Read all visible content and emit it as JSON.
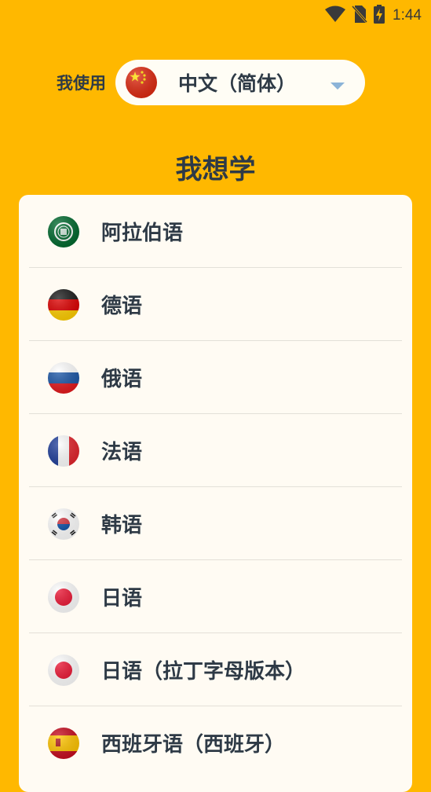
{
  "status_bar": {
    "time": "1:44",
    "icons": [
      "wifi-icon",
      "no-sim-icon",
      "battery-charging-icon"
    ]
  },
  "native_language": {
    "label": "我使用",
    "selected": "中文（简体）",
    "flag": "china-flag-icon"
  },
  "section_title": "我想学",
  "languages": [
    {
      "label": "阿拉伯语",
      "flag": "arab-league-flag-icon"
    },
    {
      "label": "德语",
      "flag": "germany-flag-icon"
    },
    {
      "label": "俄语",
      "flag": "russia-flag-icon"
    },
    {
      "label": "法语",
      "flag": "france-flag-icon"
    },
    {
      "label": "韩语",
      "flag": "south-korea-flag-icon"
    },
    {
      "label": "日语",
      "flag": "japan-flag-icon"
    },
    {
      "label": "日语（拉丁字母版本）",
      "flag": "japan-flag-icon"
    },
    {
      "label": "西班牙语（西班牙）",
      "flag": "spain-flag-icon"
    }
  ],
  "colors": {
    "background": "#FFB800",
    "card": "#FFFBF3",
    "text": "#2E3A46",
    "chevron": "#8CB4D8"
  }
}
